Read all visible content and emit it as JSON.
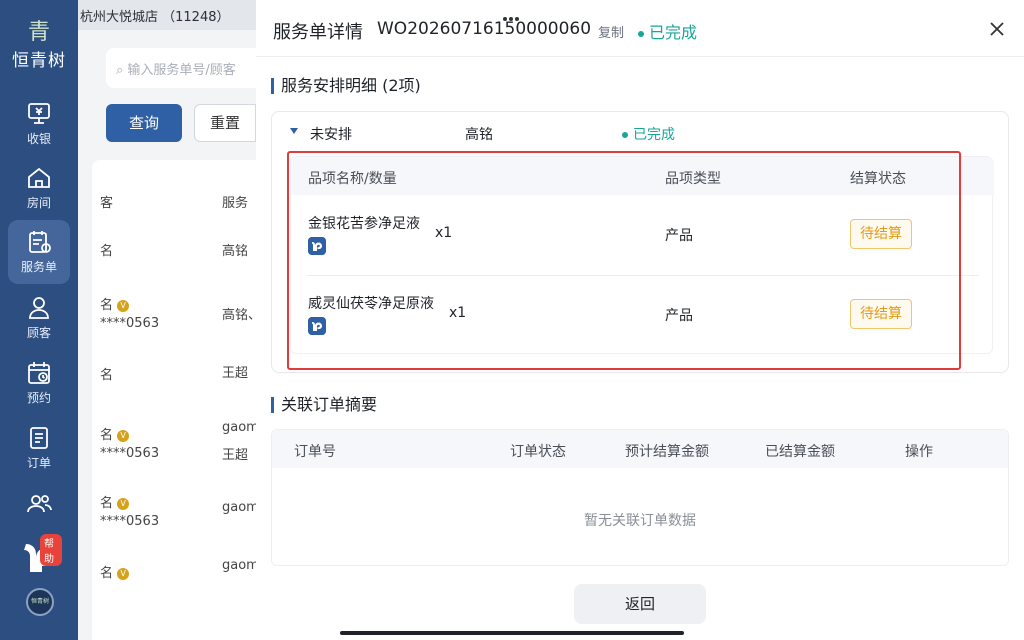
{
  "sidebar": {
    "logo_mark": "青",
    "brand": "恒青树",
    "items": [
      {
        "label": "收银",
        "icon": "cashier-icon"
      },
      {
        "label": "房间",
        "icon": "home-icon"
      },
      {
        "label": "服务单",
        "icon": "service-order-icon"
      },
      {
        "label": "顾客",
        "icon": "customer-icon"
      },
      {
        "label": "预约",
        "icon": "calendar-icon"
      },
      {
        "label": "订单",
        "icon": "order-icon"
      },
      {
        "label": "",
        "icon": "users-icon"
      }
    ],
    "help_badge": "帮助",
    "mini_logo": "恒青树"
  },
  "background": {
    "store": "杭州大悦城店 （11248）",
    "search_placeholder": "输入服务单号/顾客",
    "query_label": "查询",
    "reset_label": "重置",
    "col1": "客",
    "col2": "服务",
    "rows": [
      {
        "a": "名",
        "b": "高铭",
        "vip": false
      },
      {
        "a": "名",
        "phone": "****0563",
        "b": "高铭、",
        "vip": true
      },
      {
        "a": "名",
        "b": "王超",
        "vip": false
      },
      {
        "a": "名",
        "phone": "****0563",
        "b": "gaom",
        "b2": "王超",
        "vip": true
      },
      {
        "a": "名",
        "phone": "****0563",
        "b": "gaom",
        "vip": true
      },
      {
        "a": "名",
        "b": "gaom",
        "vip": true
      }
    ]
  },
  "drawer": {
    "title": "服务单详情",
    "order_no": "WO20260716150000060",
    "copy_label": "复制",
    "status": "已完成",
    "section1_title": "服务安排明细 (2项)",
    "group": {
      "arrangement": "未安排",
      "staff": "高铭",
      "status": "已完成"
    },
    "items_table": {
      "headers": [
        "品项名称/数量",
        "品项类型",
        "结算状态"
      ],
      "rows": [
        {
          "name": "金银花苦参净足液",
          "qty": "x1",
          "type": "产品",
          "settle": "待结算"
        },
        {
          "name": "威灵仙茯苓净足原液",
          "qty": "x1",
          "type": "产品",
          "settle": "待结算"
        }
      ]
    },
    "section2_title": "关联订单摘要",
    "orders_table": {
      "headers": [
        "订单号",
        "订单状态",
        "预计结算金额",
        "已结算金额",
        "操作"
      ],
      "empty_text": "暂无关联订单数据"
    },
    "return_label": "返回"
  },
  "colors": {
    "sidebar_bg": "#2d4e80",
    "primary": "#2f5fa5",
    "success": "#1aa59a",
    "pending": "#e69a10",
    "highlight": "#e23b3b"
  }
}
